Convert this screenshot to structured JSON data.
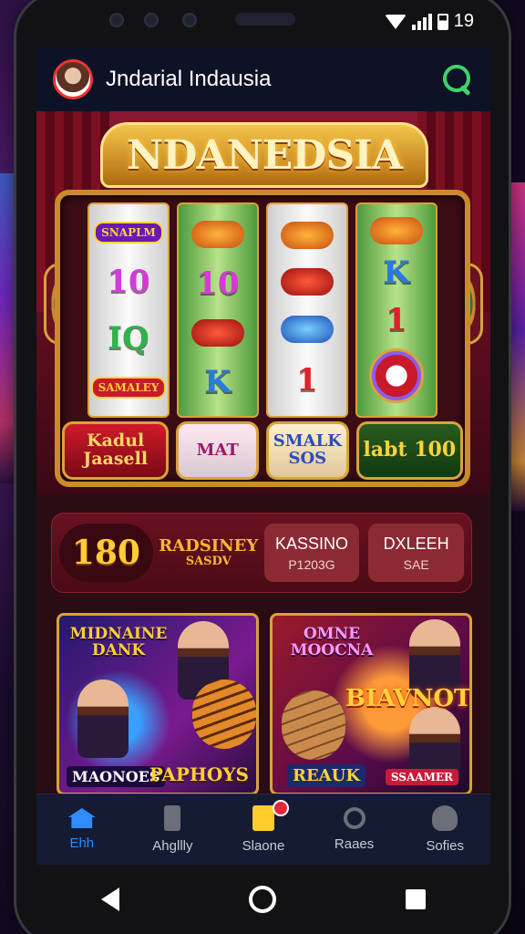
{
  "status": {
    "time": "19"
  },
  "header": {
    "title": "Jndarial Indausia"
  },
  "slot": {
    "marquee": "NDANEDSIA",
    "reels": [
      {
        "top_badge": "SNAPLM",
        "symbols": [
          "10",
          "IQ"
        ],
        "bottom_badge": "SAMALEY"
      },
      {
        "symbols": [
          "10",
          "K"
        ]
      },
      {
        "symbols": [
          "1"
        ]
      },
      {
        "symbols": [
          "K",
          "1"
        ]
      }
    ],
    "buttons": [
      "Kadul Jaasell",
      "MAT",
      "SMALK SOS",
      "labt 100"
    ]
  },
  "quick_row": {
    "jackpot": "180",
    "promo_title": "RADSINEY",
    "promo_sub": "SASDV",
    "cards": [
      {
        "title": "KASSINO",
        "sub": "P1203G"
      },
      {
        "title": "DXLEEH",
        "sub": "SAE"
      }
    ]
  },
  "games": [
    {
      "title": "MIDNAINE DANK",
      "footer_left": "MAONOES",
      "footer_right": "PAPHOYS"
    },
    {
      "title": "OMNE MOOCNA",
      "big": "BIAVNOT",
      "footer_left": "REAUK",
      "footer_right": "SSAAMER"
    }
  ],
  "tabs": [
    {
      "label": "Ehh",
      "icon": "home-icon",
      "active": true
    },
    {
      "label": "Ahgllly",
      "icon": "phone-icon"
    },
    {
      "label": "Slaone",
      "icon": "bag-icon"
    },
    {
      "label": "Raaes",
      "icon": "search-icon"
    },
    {
      "label": "Sofies",
      "icon": "user-icon"
    }
  ],
  "colors": {
    "accent": "#2f8cff",
    "header_bg": "#0d1226",
    "search_green": "#3fd36a"
  }
}
